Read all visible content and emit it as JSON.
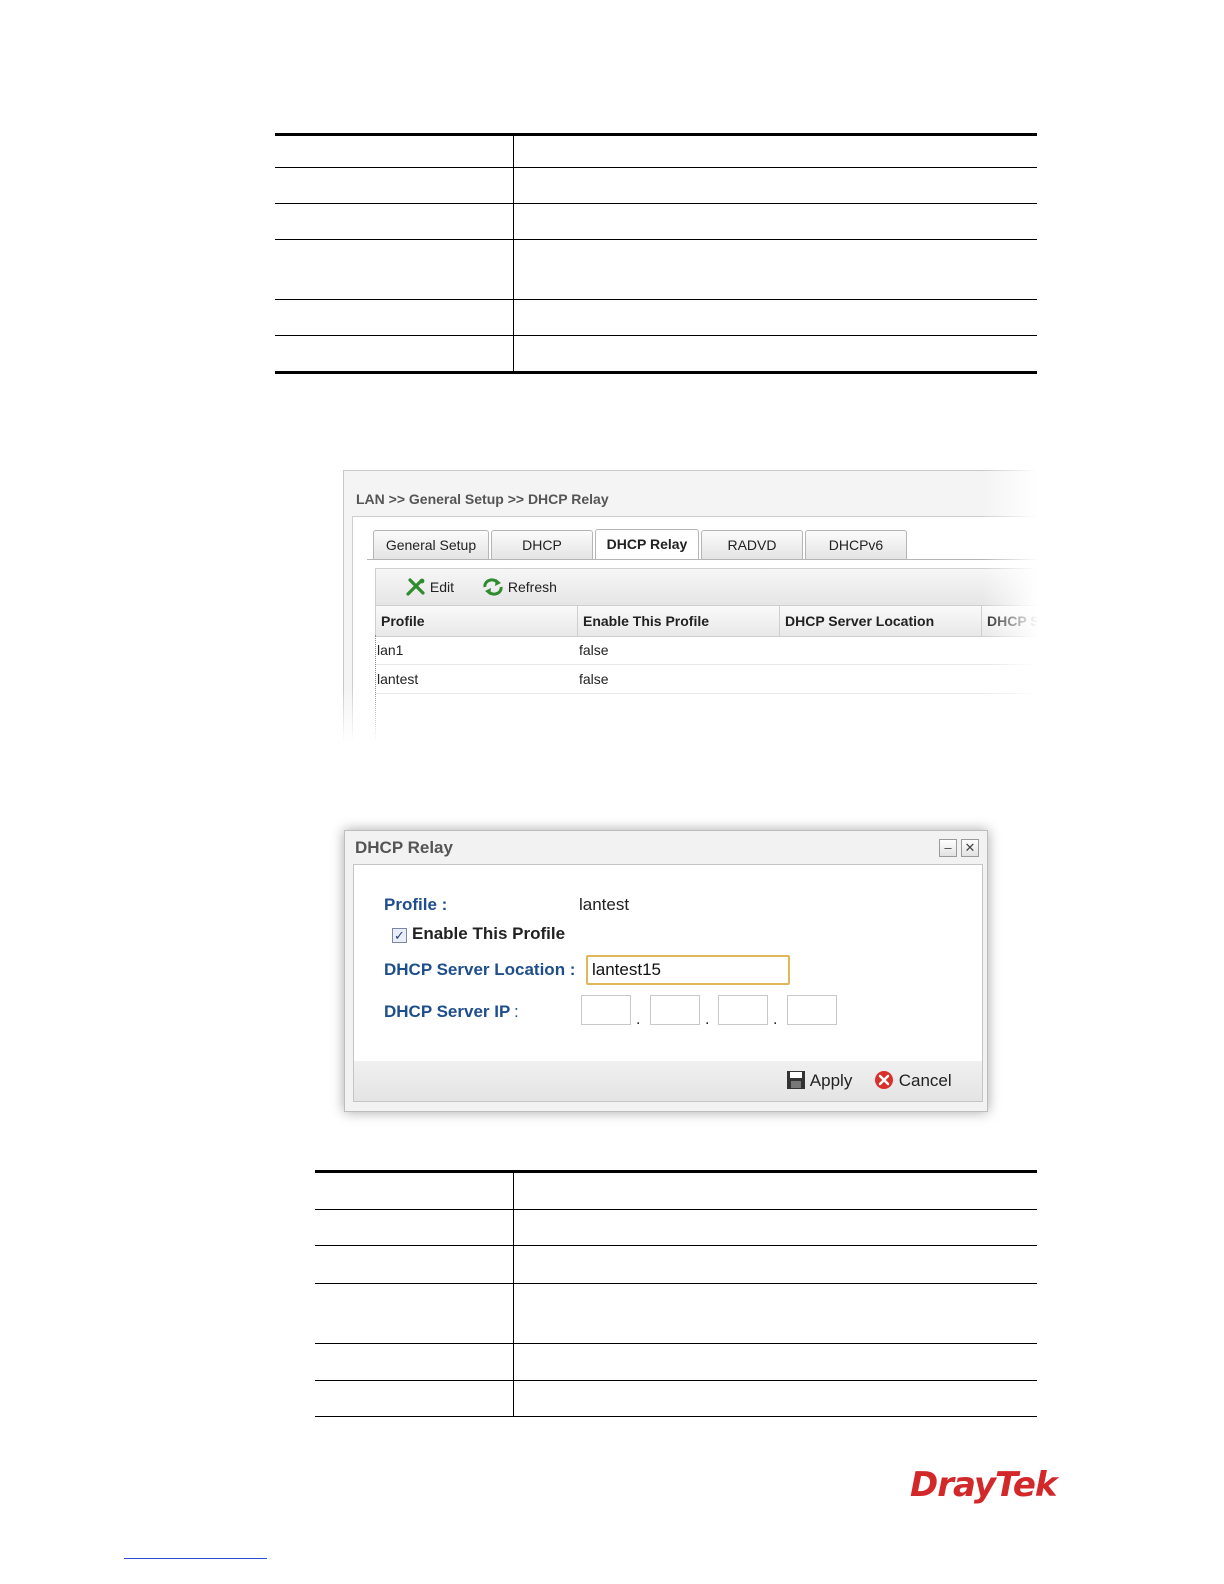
{
  "page": {
    "tables_empty": true
  },
  "relay_list": {
    "breadcrumb": "LAN >> General Setup >> DHCP Relay",
    "tabs": [
      "General Setup",
      "DHCP",
      "DHCP Relay",
      "RADVD",
      "DHCPv6"
    ],
    "active_tab": "DHCP Relay",
    "toolbar": {
      "edit": "Edit",
      "refresh": "Refresh"
    },
    "columns": [
      "Profile",
      "Enable This Profile",
      "DHCP Server Location",
      "DHCP S"
    ],
    "rows": [
      {
        "profile": "lan1",
        "enable": "false"
      },
      {
        "profile": "lantest",
        "enable": "false"
      }
    ]
  },
  "dialog": {
    "title": "DHCP Relay",
    "minimize_icon": "minimize-icon",
    "close_icon": "close-icon",
    "profile_label": "Profile :",
    "profile_value": "lantest",
    "enable_label": "Enable This Profile",
    "enable_checked": true,
    "location_label": "DHCP Server Location :",
    "location_value": "lantest15",
    "ip_label": "DHCP Server IP",
    "ip_colon": ":",
    "ip_dot": ".",
    "apply": "Apply",
    "cancel": "Cancel"
  },
  "brand": {
    "logo_text": "DrayTek",
    "color": "#d3282a"
  }
}
